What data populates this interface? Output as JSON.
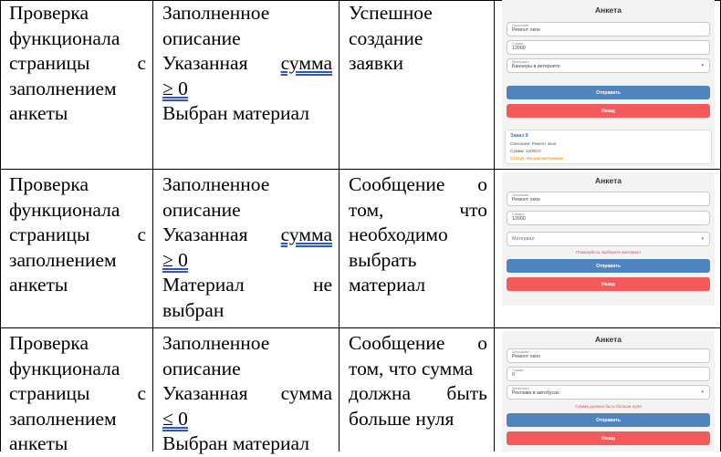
{
  "rows": [
    {
      "test": [
        "Проверка",
        "функционала",
        "страницы",
        "с",
        "заполнением",
        "анкеты"
      ],
      "input": {
        "l1": "Заполненное",
        "l2": "описание",
        "l3a": "Указанная",
        "l3b": "сумма",
        "l4": "≥ 0",
        "l5": "Выбран материал"
      },
      "expected": [
        "Успешное",
        "создание",
        "заявки"
      ],
      "shot": {
        "title": "Анкета",
        "desc_label": "Описание",
        "desc_value": "Ремонт окон",
        "sum_label": "Сумма",
        "sum_value": "12000",
        "mat_label": "Материал",
        "mat_value": "Баннеры в интернете",
        "submit": "Отправить",
        "back": "Назад",
        "order_title": "Заказ 9",
        "order_desc": "Описание: Ремонт окон",
        "order_sum": "Сумма: 12000.0",
        "order_status": "Статус: На рассмотрении"
      }
    },
    {
      "test": [
        "Проверка",
        "функционала",
        "страницы",
        "с",
        "заполнением",
        "анкеты"
      ],
      "input": {
        "l1": "Заполненное",
        "l2": "описание",
        "l3a": "Указанная",
        "l3b": "сумма",
        "l4": "≥ 0",
        "l5a": "Материал",
        "l5b": "не",
        "l6": "выбран"
      },
      "expected": [
        "Сообщение",
        "о",
        "том,",
        "что",
        "необходимо",
        "выбрать",
        "материал"
      ],
      "shot": {
        "title": "Анкета",
        "desc_label": "Описание",
        "desc_value": "Ремонт окон",
        "sum_label": "Сумма",
        "sum_value": "12000",
        "mat_placeholder": "Материал",
        "error": "Пожалуйста, выберите материал",
        "submit": "Отправить",
        "back": "Назад"
      }
    },
    {
      "test": [
        "Проверка",
        "функционала",
        "страницы",
        "с",
        "заполнением",
        "анкеты"
      ],
      "input": {
        "l1": "Заполненное",
        "l2": "описание",
        "l3": "Указанная сумма",
        "l4": "≤ 0",
        "l5": "Выбран материал"
      },
      "expected": [
        "Сообщение",
        "о",
        "том, что сумма",
        "должна",
        "быть",
        "больше нуля"
      ],
      "shot": {
        "title": "Анкета",
        "desc_label": "Описание",
        "desc_value": "Ремонт окон",
        "sum_label": "Сумма",
        "sum_value": "0",
        "mat_label": "Материал",
        "mat_value": "Реклама в автобусах",
        "error": "Сумма должна быть больше нуля",
        "submit": "Отправить",
        "back": "Назад"
      }
    }
  ]
}
